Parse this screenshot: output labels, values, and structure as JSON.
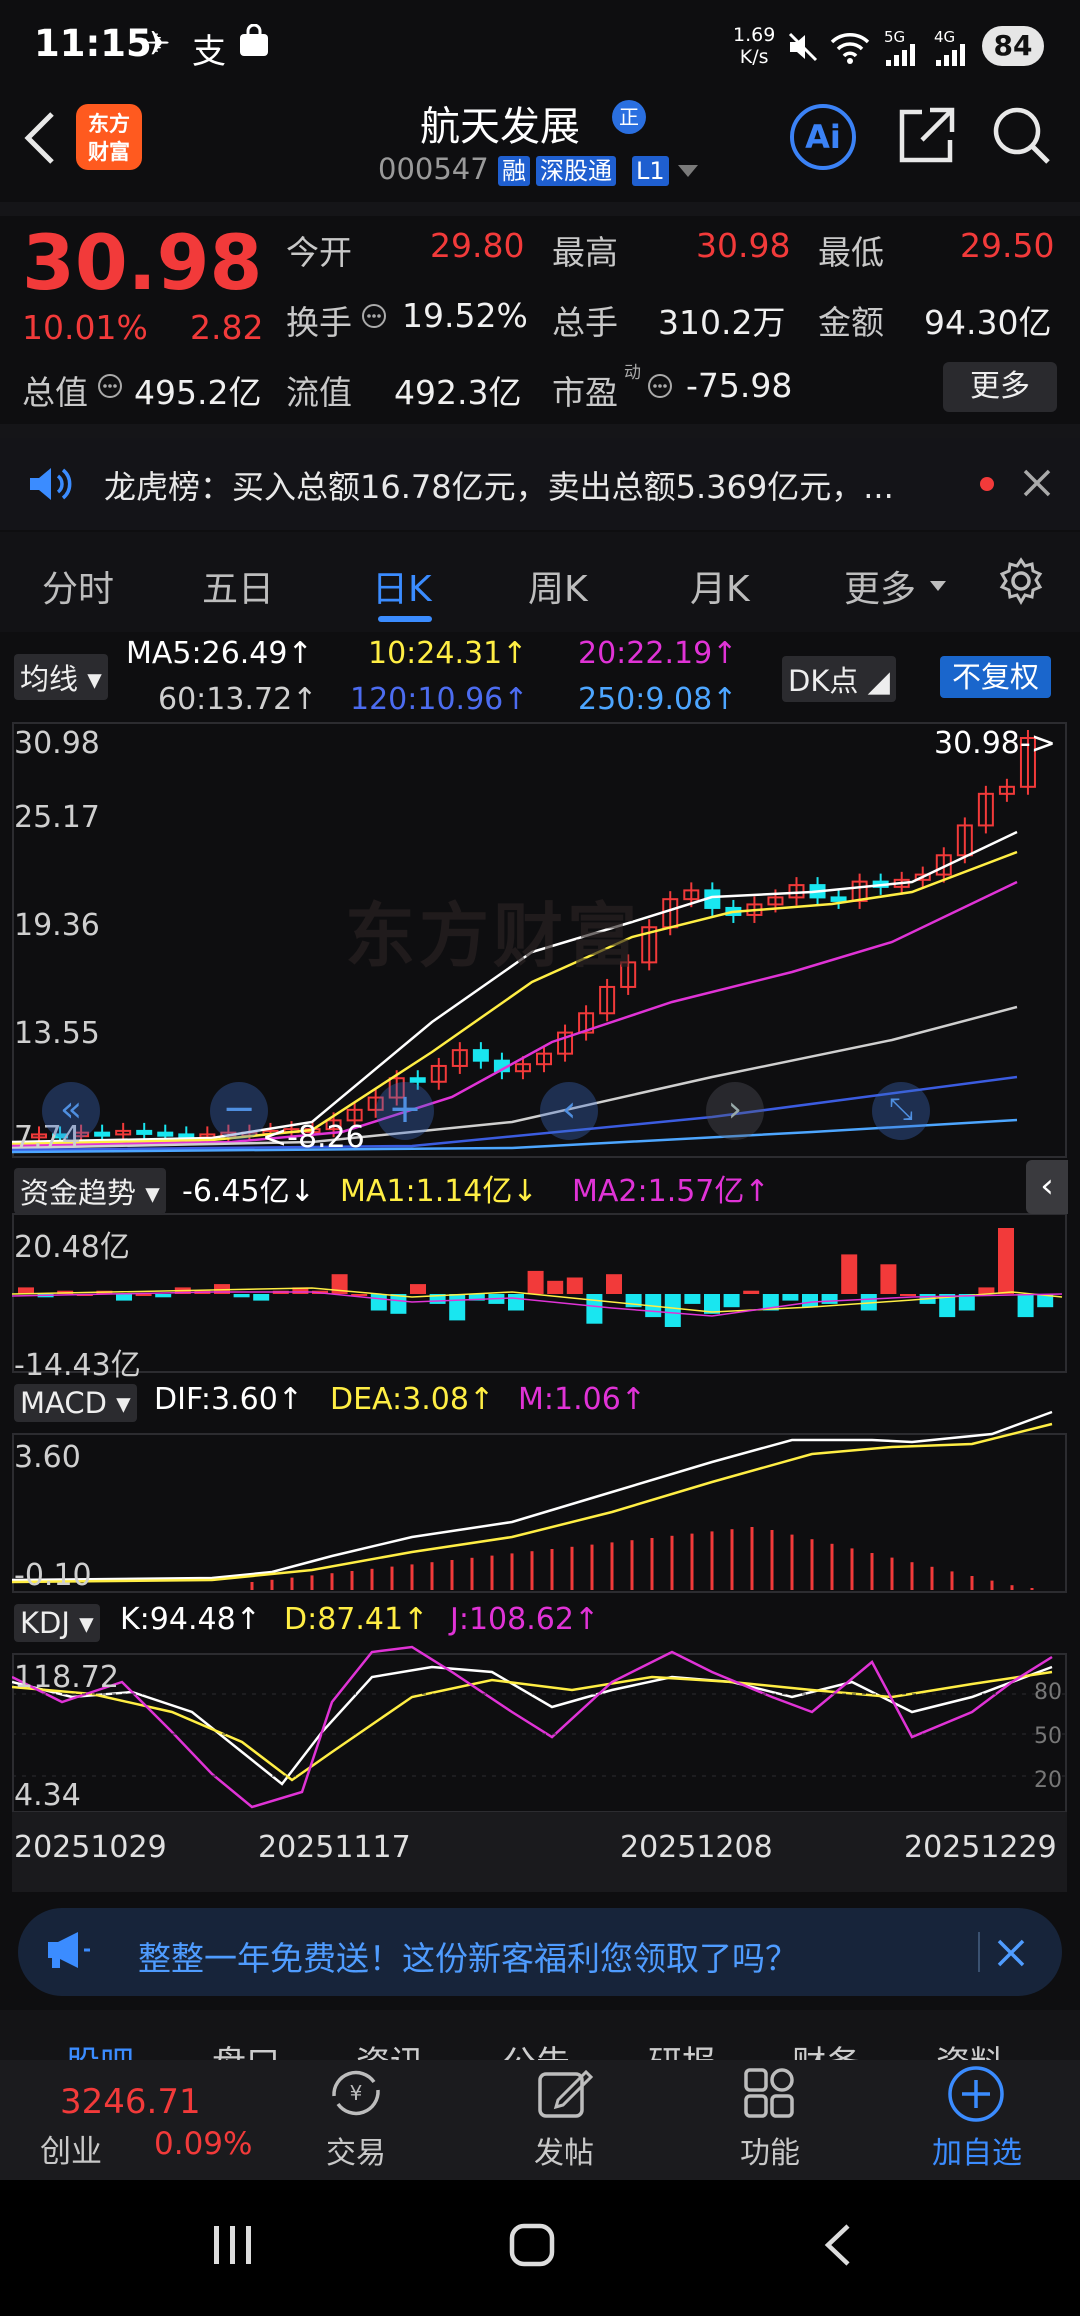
{
  "status": {
    "time": "11:15",
    "speed_value": "1.69",
    "speed_unit": "K/s",
    "net1": "5G",
    "net2": "4G",
    "battery": "84"
  },
  "header": {
    "logo": "东方财富",
    "title": "航天发展",
    "title_badge": "正",
    "code": "000547",
    "tags": [
      "融",
      "深股通",
      "L1"
    ],
    "ai_label": "Ai"
  },
  "quote": {
    "price": "30.98",
    "pct": "10.01%",
    "change": "2.82",
    "open_label": "今开",
    "open": "29.80",
    "high_label": "最高",
    "high": "30.98",
    "low_label": "最低",
    "low": "29.50",
    "turnover_label": "换手",
    "turnover": "19.52%",
    "volume_label": "总手",
    "volume": "310.2万",
    "amount_label": "金额",
    "amount": "94.30亿",
    "mcap_label": "总值",
    "mcap": "495.2亿",
    "float_label": "流值",
    "float": "492.3亿",
    "pe_label": "市盈",
    "pe_sup": "动",
    "pe": "-75.98",
    "more": "更多"
  },
  "notice": {
    "text": "龙虎榜：买入总额16.78亿元，卖出总额5.369亿元，..."
  },
  "tabs": [
    "分时",
    "五日",
    "日K",
    "周K",
    "月K",
    "更多"
  ],
  "active_tab": "日K",
  "kline": {
    "ma_selector": "均线",
    "ma5": "MA5:26.49",
    "ma10": "10:24.31",
    "ma20": "20:22.19",
    "ma60": "60:13.72",
    "ma120": "120:10.96",
    "ma250": "250:9.08",
    "dk_button": "DK点",
    "fq_button": "不复权",
    "watermark": "东方财富",
    "price_label": "30.98->",
    "low_label": "<-8.26",
    "y_ticks": [
      "30.98",
      "25.17",
      "19.36",
      "13.55",
      "7.74"
    ],
    "colors": {
      "up": "#f23a3a",
      "down": "#19e6f0",
      "ma5": "#ffffff",
      "ma10": "#ffee44",
      "ma20": "#e033d6",
      "ma60": "#cfcfcf",
      "ma120": "#3b5ce0",
      "ma250": "#4da6ff"
    }
  },
  "funds": {
    "selector": "资金趋势",
    "value": "-6.45亿",
    "ma1": "MA1:1.14亿",
    "ma2": "MA2:1.57亿",
    "y_ticks": [
      "20.48亿",
      "-14.43亿"
    ]
  },
  "macd": {
    "selector": "MACD",
    "dif": "DIF:3.60",
    "dea": "DEA:3.08",
    "m": "M:1.06",
    "y_ticks": [
      "3.60",
      "-0.10"
    ]
  },
  "kdj": {
    "selector": "KDJ",
    "k": "K:94.48",
    "d": "D:87.41",
    "j": "J:108.62",
    "y_ticks": [
      "118.72",
      "4.34"
    ],
    "right_ticks": [
      "80",
      "50",
      "20"
    ]
  },
  "x_dates": [
    "20251029",
    "20251117",
    "20251208",
    "20251229"
  ],
  "banner": {
    "text": "整整一年免费送！这份新客福利您领取了吗？"
  },
  "bottom_tabs": [
    "股吧",
    "盘口",
    "资讯",
    "公告",
    "研报",
    "财务",
    "资料"
  ],
  "bottom": {
    "index_value": "3246.71",
    "index_name": "创业",
    "index_pct": "0.09%",
    "trade": "交易",
    "post": "发帖",
    "func": "功能",
    "add": "加自选"
  }
}
